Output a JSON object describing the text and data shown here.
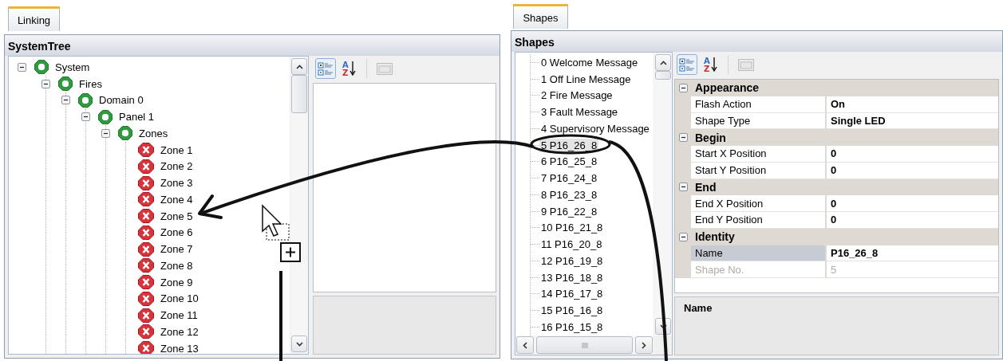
{
  "linking": {
    "tab": {
      "label": "Linking",
      "selected": true
    },
    "title": "SystemTree",
    "tree": [
      {
        "label": "System",
        "kind": "group",
        "expanded": true,
        "children": [
          {
            "label": "Fires",
            "kind": "group",
            "expanded": true,
            "children": [
              {
                "label": "Domain 0",
                "kind": "group",
                "expanded": true,
                "children": [
                  {
                    "label": "Panel 1",
                    "kind": "group",
                    "expanded": true,
                    "children": [
                      {
                        "label": "Zones",
                        "kind": "group",
                        "expanded": true,
                        "children": [
                          {
                            "label": "Zone 1",
                            "kind": "zone"
                          },
                          {
                            "label": "Zone 2",
                            "kind": "zone"
                          },
                          {
                            "label": "Zone 3",
                            "kind": "zone"
                          },
                          {
                            "label": "Zone 4",
                            "kind": "zone"
                          },
                          {
                            "label": "Zone 5",
                            "kind": "zone"
                          },
                          {
                            "label": "Zone 6",
                            "kind": "zone"
                          },
                          {
                            "label": "Zone 7",
                            "kind": "zone"
                          },
                          {
                            "label": "Zone 8",
                            "kind": "zone"
                          },
                          {
                            "label": "Zone 9",
                            "kind": "zone"
                          },
                          {
                            "label": "Zone 10",
                            "kind": "zone"
                          },
                          {
                            "label": "Zone 11",
                            "kind": "zone"
                          },
                          {
                            "label": "Zone 12",
                            "kind": "zone"
                          },
                          {
                            "label": "Zone 13",
                            "kind": "zone"
                          }
                        ]
                      }
                    ]
                  }
                ]
              }
            ]
          }
        ]
      }
    ],
    "toolbar": [
      {
        "kind": "categorized",
        "selected": true,
        "disabled": false
      },
      {
        "kind": "alphabetical",
        "glyphs": [
          "A",
          "Z"
        ],
        "selected": false,
        "disabled": false
      },
      {
        "kind": "property-pages",
        "selected": false,
        "disabled": true
      }
    ]
  },
  "shapes": {
    "tab": {
      "label": "Shapes",
      "selected": true
    },
    "title": "Shapes",
    "items": [
      {
        "label": "0 Welcome Message",
        "selected": false
      },
      {
        "label": "1 Off Line Message",
        "selected": false
      },
      {
        "label": "2 Fire Message",
        "selected": false
      },
      {
        "label": "3 Fault Message",
        "selected": false
      },
      {
        "label": "4 Supervisory Message",
        "selected": false
      },
      {
        "label": "5 P16_26_8",
        "selected": true
      },
      {
        "label": "6 P16_25_8",
        "selected": false
      },
      {
        "label": "7 P16_24_8",
        "selected": false
      },
      {
        "label": "8 P16_23_8",
        "selected": false
      },
      {
        "label": "9 P16_22_8",
        "selected": false
      },
      {
        "label": "10 P16_21_8",
        "selected": false
      },
      {
        "label": "11 P16_20_8",
        "selected": false
      },
      {
        "label": "12 P16_19_8",
        "selected": false
      },
      {
        "label": "13 P16_18_8",
        "selected": false
      },
      {
        "label": "14 P16_17_8",
        "selected": false
      },
      {
        "label": "15 P16_16_8",
        "selected": false
      },
      {
        "label": "16 P16_15_8",
        "selected": false
      }
    ],
    "toolbar": [
      {
        "kind": "categorized",
        "selected": true,
        "disabled": false
      },
      {
        "kind": "alphabetical",
        "glyphs": [
          "A",
          "Z"
        ],
        "selected": false,
        "disabled": false
      },
      {
        "kind": "property-pages",
        "selected": false,
        "disabled": true
      }
    ],
    "properties": [
      {
        "category": "Appearance",
        "expanded": true,
        "rows": [
          {
            "name": "Flash Action",
            "value": "On",
            "selected": false,
            "disabled": false
          },
          {
            "name": "Shape Type",
            "value": "Single LED",
            "selected": false,
            "disabled": false
          }
        ]
      },
      {
        "category": "Begin",
        "expanded": true,
        "rows": [
          {
            "name": "Start X Position",
            "value": "0",
            "selected": false,
            "disabled": false
          },
          {
            "name": "Start Y Position",
            "value": "0",
            "selected": false,
            "disabled": false
          }
        ]
      },
      {
        "category": "End",
        "expanded": true,
        "rows": [
          {
            "name": "End X Position",
            "value": "0",
            "selected": false,
            "disabled": false
          },
          {
            "name": "End Y Position",
            "value": "0",
            "selected": false,
            "disabled": false
          }
        ]
      },
      {
        "category": "Identity",
        "expanded": true,
        "rows": [
          {
            "name": "Name",
            "value": "P16_26_8",
            "selected": true,
            "disabled": false
          },
          {
            "name": "Shape No.",
            "value": "5",
            "selected": false,
            "disabled": true
          }
        ]
      }
    ],
    "description": {
      "title": "Name"
    }
  }
}
